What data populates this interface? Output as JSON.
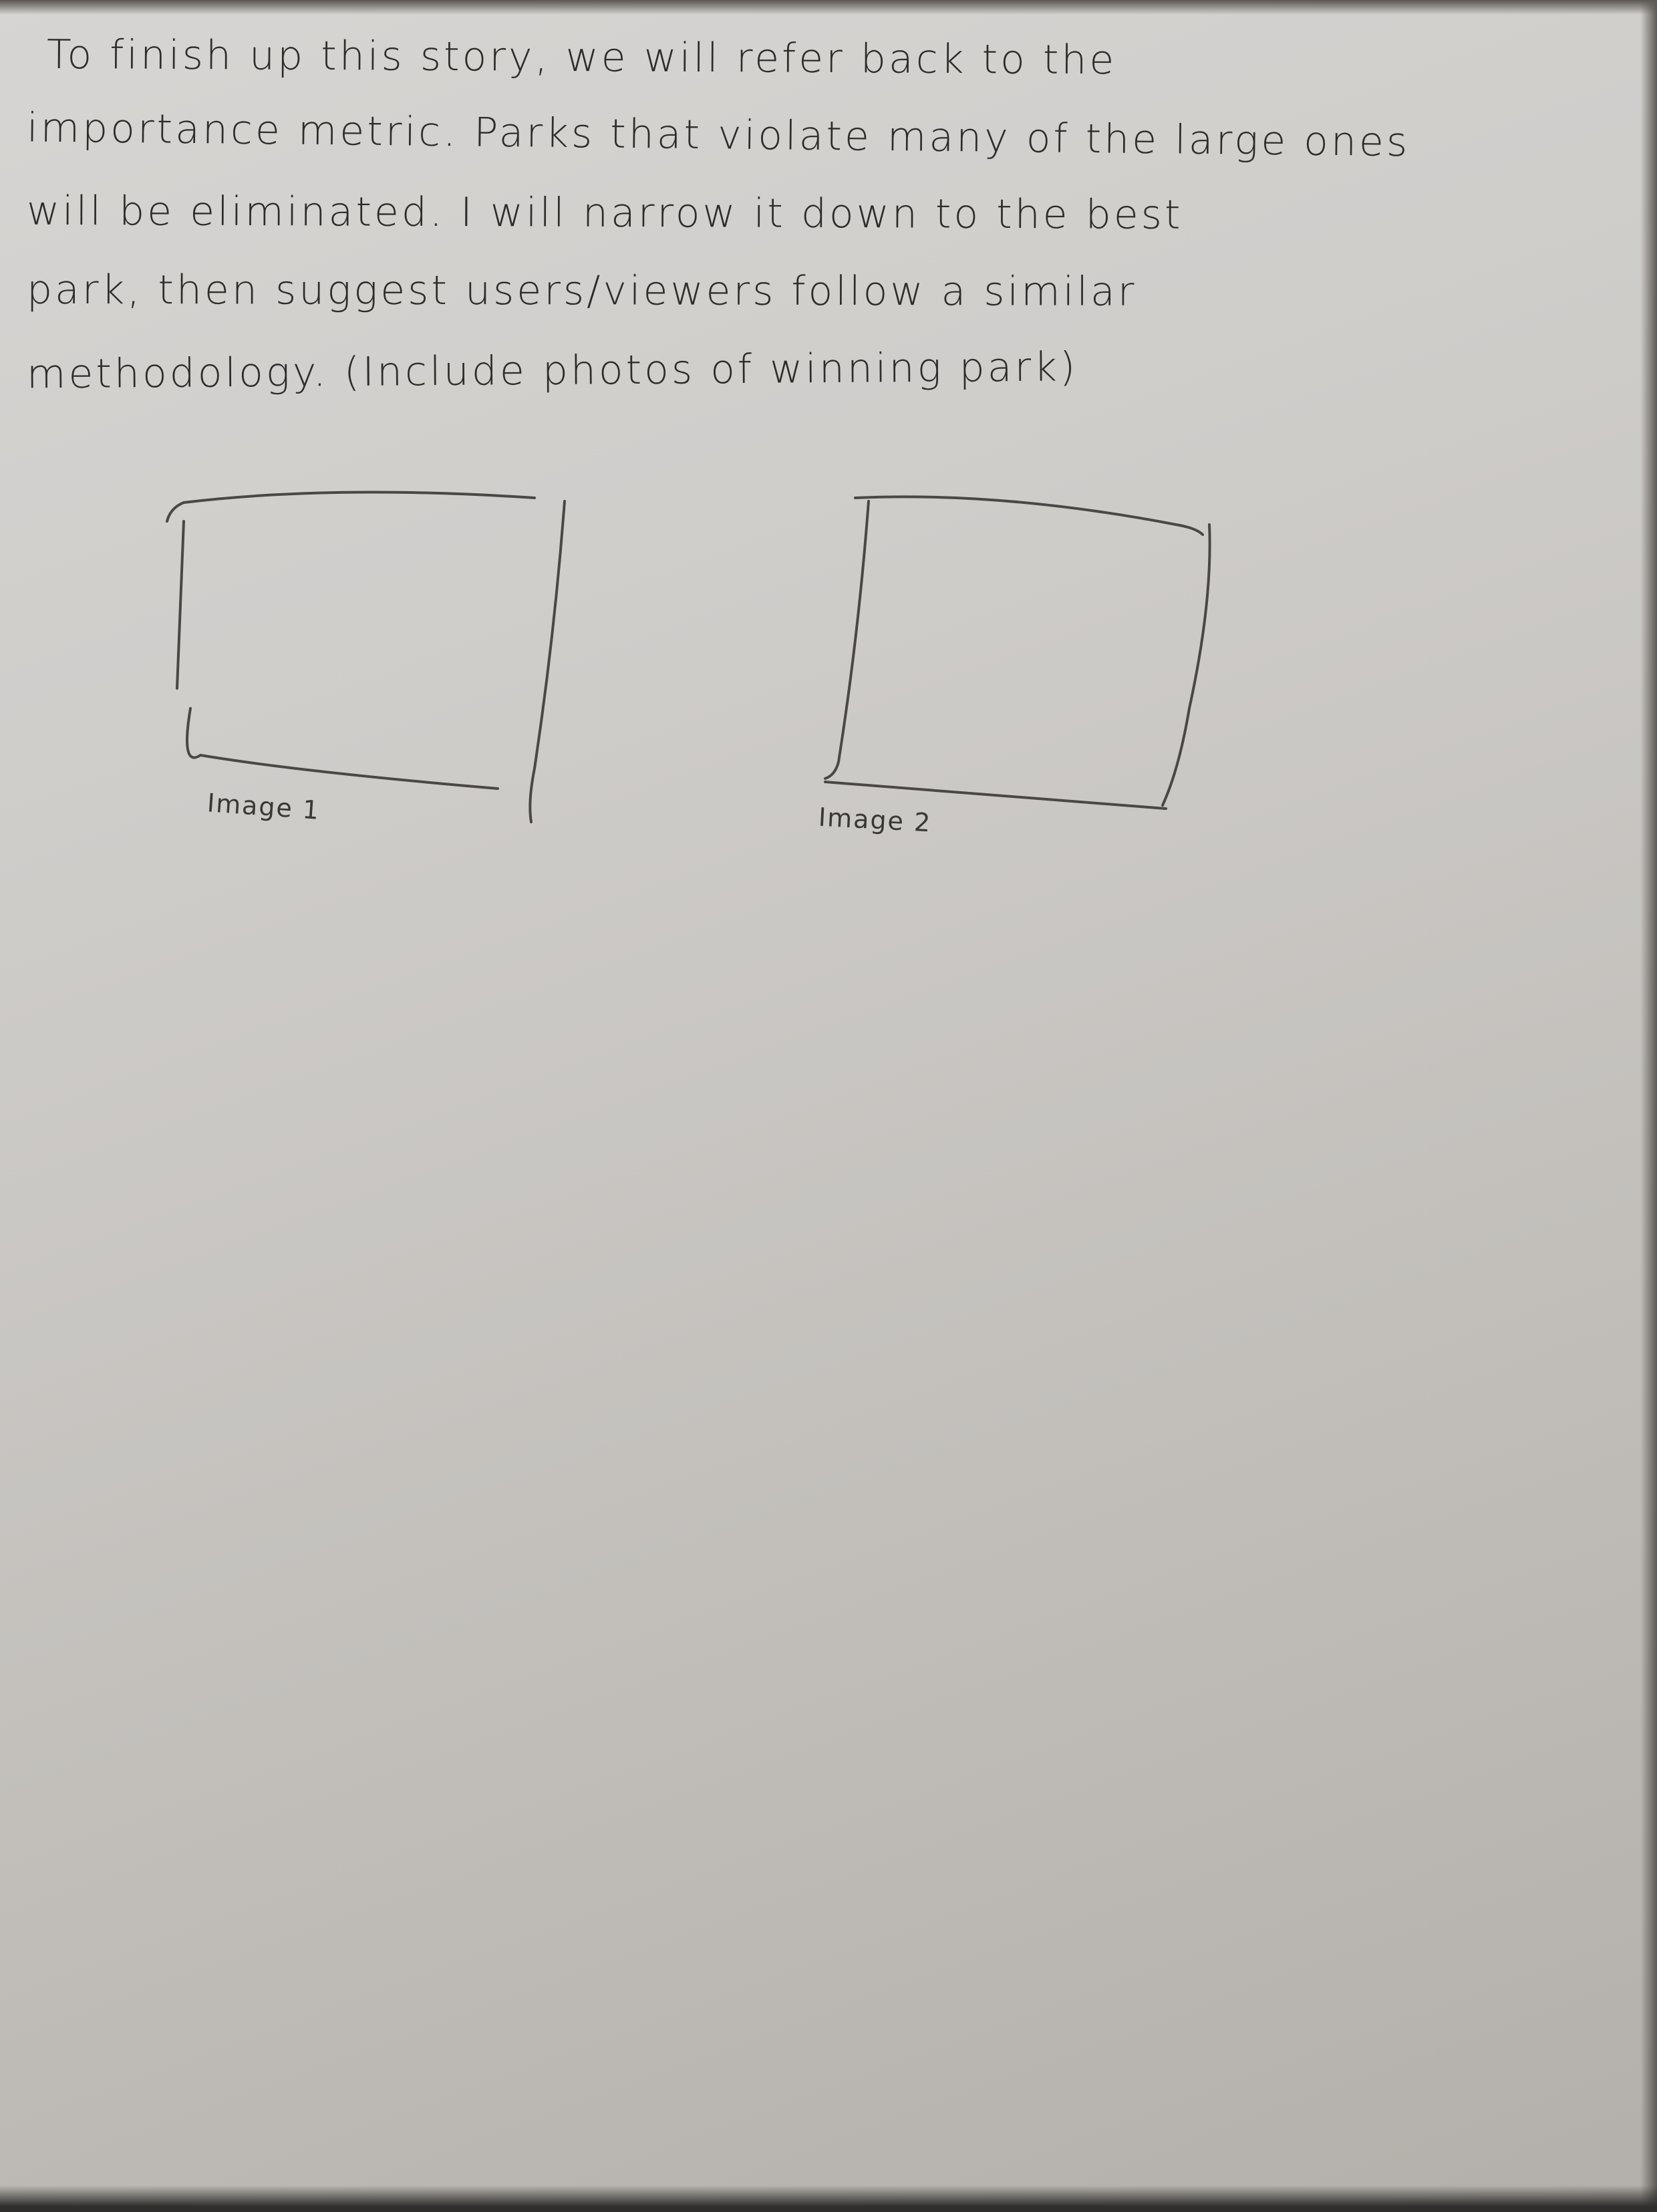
{
  "note": {
    "lines": [
      "To finish up this story, we will refer back to the",
      "importance metric. Parks that violate many of the large ones",
      "will be eliminated. I will narrow it down to the best",
      "park, then suggest users/viewers follow a similar",
      "methodology. (Include photos of winning park)"
    ]
  },
  "placeholders": [
    {
      "caption": "Image 1"
    },
    {
      "caption": "Image 2"
    }
  ],
  "colors": {
    "paper": "#cfcdca",
    "pencil": "#2e2c2a",
    "table": "#54504c"
  }
}
